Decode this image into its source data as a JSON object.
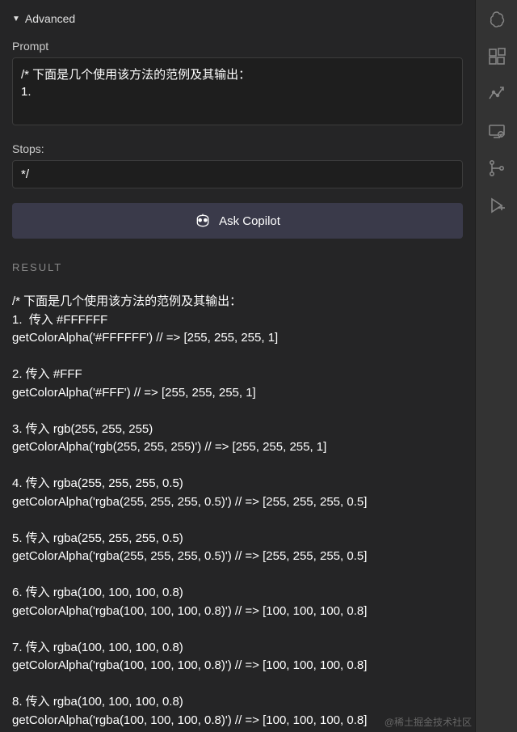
{
  "header": {
    "title": "Advanced"
  },
  "prompt": {
    "label": "Prompt",
    "value": "/* 下面是几个使用该方法的范例及其输出：\n1."
  },
  "stops": {
    "label": "Stops:",
    "value": "*/"
  },
  "button": {
    "label": "Ask Copilot"
  },
  "result": {
    "label": "RESULT",
    "body": "/* 下面是几个使用该方法的范例及其输出：\n1.  传入 #FFFFFF\ngetColorAlpha('#FFFFFF') // => [255, 255, 255, 1]\n\n2. 传入 #FFF\ngetColorAlpha('#FFF') // => [255, 255, 255, 1]\n\n3. 传入 rgb(255, 255, 255)\ngetColorAlpha('rgb(255, 255, 255)') // => [255, 255, 255, 1]\n\n4. 传入 rgba(255, 255, 255, 0.5)\ngetColorAlpha('rgba(255, 255, 255, 0.5)') // => [255, 255, 255, 0.5]\n\n5. 传入 rgba(255, 255, 255, 0.5)\ngetColorAlpha('rgba(255, 255, 255, 0.5)') // => [255, 255, 255, 0.5]\n\n6. 传入 rgba(100, 100, 100, 0.8)\ngetColorAlpha('rgba(100, 100, 100, 0.8)') // => [100, 100, 100, 0.8]\n\n7. 传入 rgba(100, 100, 100, 0.8)\ngetColorAlpha('rgba(100, 100, 100, 0.8)') // => [100, 100, 100, 0.8]\n\n8. 传入 rgba(100, 100, 100, 0.8)\ngetColorAlpha('rgba(100, 100, 100, 0.8)') // => [100, 100, 100, 0.8]"
  },
  "watermark": "@稀土掘金技术社区",
  "icons": {
    "openai": "openai-icon",
    "extensions": "extensions-icon",
    "graph": "graph-icon",
    "remote": "remote-icon",
    "git": "git-icon",
    "debug": "debug-icon"
  }
}
